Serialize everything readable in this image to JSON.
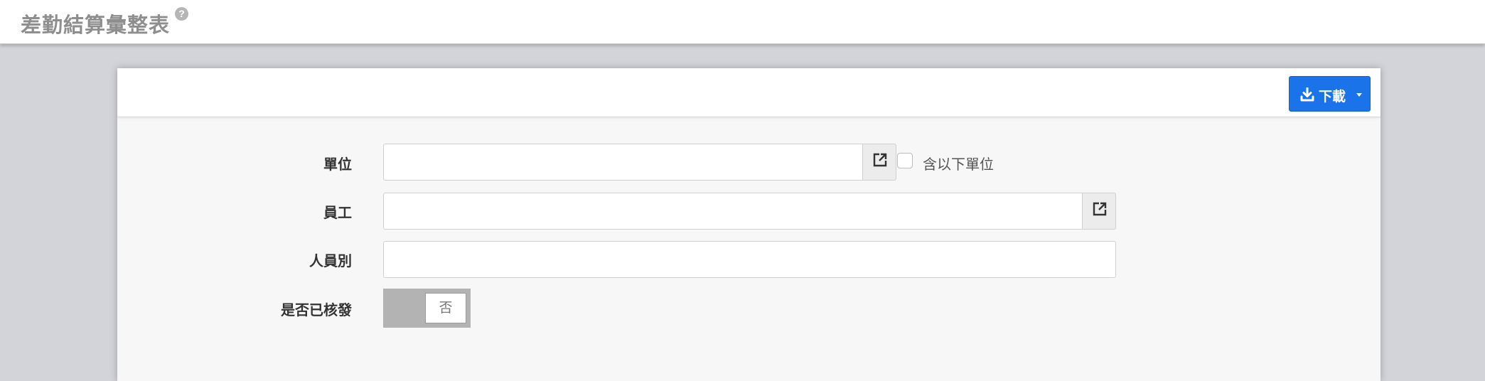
{
  "page": {
    "title": "差勤結算彙整表",
    "help_symbol": "?"
  },
  "toolbar": {
    "download_label": "下載"
  },
  "form": {
    "unit": {
      "label": "單位",
      "value": "",
      "include_sub_label": "含以下單位",
      "include_sub_checked": false
    },
    "employee": {
      "label": "員工",
      "value": ""
    },
    "personnel_type": {
      "label": "人員別",
      "value": ""
    },
    "issued": {
      "label": "是否已核發",
      "toggle_text": "否",
      "on": false
    }
  },
  "colors": {
    "accent": "#1a73e8",
    "title_gray": "#8e8e8e",
    "background": "#d3d4d9"
  },
  "icons": [
    "help-icon",
    "download-icon",
    "caret-down-icon",
    "external-link-icon"
  ]
}
